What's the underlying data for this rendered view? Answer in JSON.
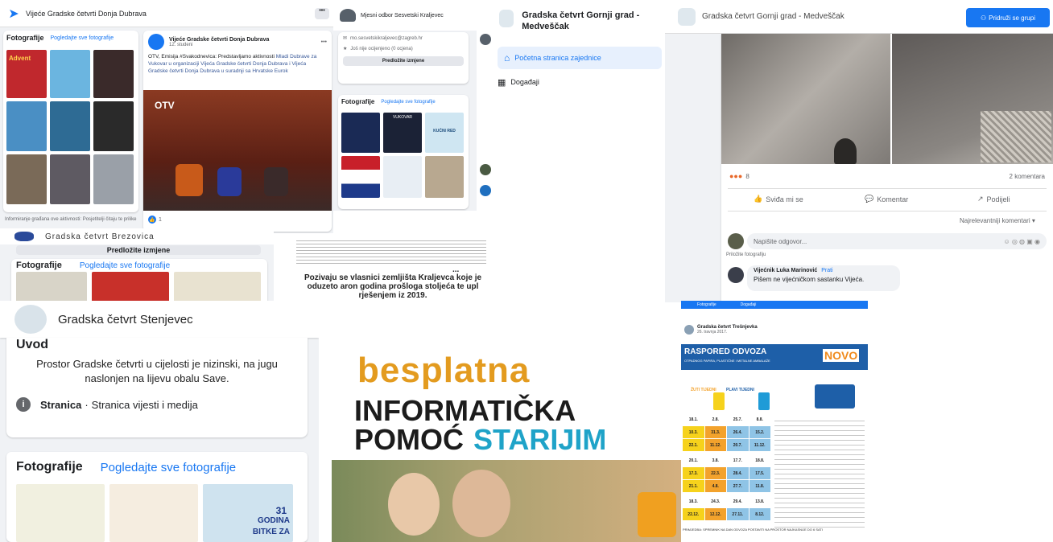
{
  "panel_a": {
    "page_name": "Vijeće Gradske četvrti Donja Dubrava",
    "photos_title": "Fotografije",
    "photos_link": "Pogledajte sve fotografije",
    "post_author": "Vijeće Gradske četvrti Donja Dubrava",
    "post_date": "12. studeni",
    "post_text_1": "OTV, Emisija #Svakodnevica: Predstavljamo aktivnosti",
    "post_text_2": "Mladi Dubrave za Vukovar u organizaciji Vijeća Gradske četvrti Donja Dubrava i Vijeća Gradske četvrti Donja Dubrava u suradnji sa Hrvatske Eurok",
    "post_reactions": "1",
    "poster_title": "Advent",
    "tv_logo": "OTV",
    "caption_left": "Informiranje građana ove aktivnosti: Posjetitelji čitaju te prilike",
    "more_dots": "•••"
  },
  "panel_b": {
    "page_name": "Mjesni odbor Sesvetski Kraljevec",
    "email": "mo.sesvetskikraljevec@zagreb.hr",
    "rating": "Još nije ocijenjeno (0 ocjena)",
    "button": "Predložite izmjene",
    "photos_title": "Fotografije",
    "photos_link": "Pogledajte sve fotografije",
    "thumb_label_1": "VUKOVAR",
    "thumb_label_2": "KUĆNI RED"
  },
  "panel_c": {
    "page_name": "Gradska četvrt Brezovica",
    "button": "Predložite izmjene",
    "photos_title": "Fotografije",
    "photos_link": "Pogledajte sve fotografije"
  },
  "panel_d": {
    "snippet_heading": "Pozivaju se vlasnici zemljišta Kraljevca koje je oduzeto aron godina prošloga stoljeća te upl rješenjem iz 2019.",
    "ellipsis": "..."
  },
  "panel_e": {
    "group_name": "Gradska četvrt Gornji grad - Medveščak",
    "nav_home": "Početna stranica zajednice",
    "nav_events": "Događaji"
  },
  "panel_f": {
    "group_name": "Gradska četvrt Gornji grad - Medveščak",
    "join_button": "Pridruži se grupi",
    "reaction_count": "8",
    "comments_count": "2 komentara",
    "action_like": "Sviđa mi se",
    "action_comment": "Komentar",
    "action_share": "Podijeli",
    "sort_label": "Najrelevantniji komentari",
    "reply_placeholder": "Napišite odgovor...",
    "attach_hint": "Priložite fotografiju",
    "commenter": "Vijećnik Luka Marinović",
    "commenter_tag": "Prati",
    "comment_text": "Pišem ne vijećničkom sastanku Vijeća."
  },
  "panel_g": {
    "page_name": "Gradska četvrt Stenjevec",
    "intro_title": "Uvod",
    "intro_text": "Prostor Gradske četvrti u cijelosti je nizinski, na jugu naslonjen na lijevu obalu Save.",
    "page_type": "Stranica",
    "page_category": "Stranica vijesti i medija",
    "photos_title": "Fotografije",
    "photos_link": "Pogledajte sve fotografije",
    "photo_badge_number": "31",
    "photo_badge_word": "GODINA",
    "photo_badge_word2": "BITKE ZA"
  },
  "panel_h": {
    "line1": "besplatna",
    "line2": "INFORMATIČKA",
    "line3_a": "POMOĆ",
    "line3_b": "STARIJIM"
  },
  "panel_i": {
    "page_name": "Gradska četvrt Trešnjevka",
    "post_date": "26. travnja 2017.",
    "banner_title": "RASPORED ODVOZA",
    "banner_sub": "OTPADNOG PAPIRA, PLASTIČNE I METALNE AMBALAŽE",
    "banner_new": "NOVO",
    "bin_yellow": "ŽUTI TIJEDNI",
    "bin_blue": "PLAVI TIJEDNI",
    "footer_note": "PRIMJEDBA: SPREMNIK NA DAN ODVOZA POSTAVITI NA PROSTOR NAJKASNIJE DO 6 SATI",
    "tabs_left": "Fotografije",
    "tabs_right": "Događaji"
  },
  "colors": {
    "fb_blue": "#1877f2",
    "besplatna_orange": "#e39b1f",
    "starijim_cyan": "#1fa3c8",
    "banner_blue": "#1e5fa8",
    "banner_orange": "#f08a1c",
    "yellow_cell": "#f6d21c",
    "orange_cell": "#f3a22c"
  },
  "icons": [
    "logo-icon",
    "more-icon",
    "mail-icon",
    "star-icon",
    "home-icon",
    "calendar-icon",
    "info-icon",
    "like-icon",
    "comment-icon",
    "share-icon",
    "camera-icon",
    "emoji-icon",
    "gif-icon",
    "sticker-icon",
    "truck-icon",
    "bin-icon"
  ],
  "table_rows": [
    [
      "18.1.",
      "2.8.",
      "25.7.",
      "8.8."
    ],
    [
      "10.3.",
      "31.3.",
      "26.4.",
      "15.2."
    ],
    [
      "22.1.",
      "11.12.",
      "20.7.",
      "11.12."
    ],
    [
      "20.1.",
      "3.8.",
      "17.7.",
      "18.8."
    ],
    [
      "17.3.",
      "22.3.",
      "28.4.",
      "17.5."
    ],
    [
      "21.1.",
      "4.8.",
      "27.7.",
      "11.8."
    ],
    [
      "18.3.",
      "24.3.",
      "29.4.",
      "13.8."
    ],
    [
      "22.12.",
      "12.12.",
      "27.11.",
      "8.12."
    ]
  ]
}
